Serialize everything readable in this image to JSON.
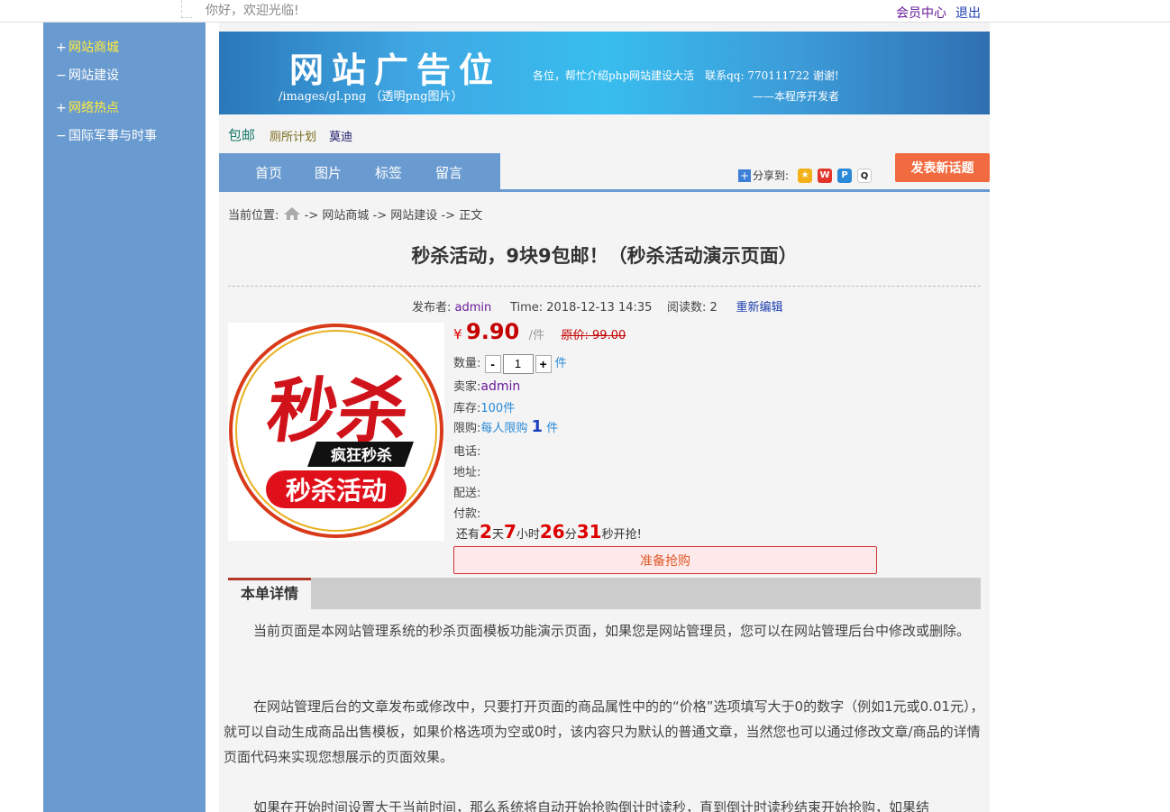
{
  "topbar": {
    "greeting": "你好，欢迎光临!",
    "member_center": "会员中心",
    "logout": "退出"
  },
  "sidebar": {
    "items": [
      {
        "marker": "+",
        "label": "网站商城"
      },
      {
        "marker": "−",
        "label": "网站建设"
      },
      {
        "marker": "+",
        "label": "网络热点"
      },
      {
        "marker": "−",
        "label": "国际军事与时事"
      }
    ]
  },
  "banner": {
    "title": "网站广告位",
    "subtitle": "/images/gl.png （透明png图片）",
    "message": "各位，帮忙介绍php网站建设大活　联系qq: 770111722 谢谢!",
    "signature": "——本程序开发者"
  },
  "tags": [
    "包邮",
    "厕所计划",
    "莫迪"
  ],
  "nav": {
    "items": [
      "首页",
      "图片",
      "标签",
      "留言"
    ],
    "share_label": "分享到:",
    "post_button": "发表新话题"
  },
  "breadcrumb": {
    "prefix": "当前位置:",
    "sep": "->",
    "items": [
      "网站商城",
      "网站建设",
      "正文"
    ]
  },
  "article": {
    "title": "秒杀活动，9块9包邮！（秒杀活动演示页面）",
    "publisher_label": "发布者:",
    "publisher": "admin",
    "time_label": "Time:",
    "time": "2018-12-13 14:35",
    "reads_label": "阅读数:",
    "reads": "2",
    "edit": "重新编辑"
  },
  "product": {
    "image_text_top": "秒杀",
    "image_text_mid": "疯狂秒杀",
    "image_text_bottom": "秒杀活动",
    "currency": "¥",
    "price": "9.90",
    "unit": "/件",
    "original_price": "原价: 99.00",
    "qty_label": "数量:",
    "qty_minus": "-",
    "qty_value": "1",
    "qty_plus": "+",
    "qty_unit": "件",
    "seller_label": "卖家:",
    "seller": "admin",
    "stock_label": "库存:",
    "stock": "100件",
    "limit_label": "限购:",
    "limit_prefix": "每人限购",
    "limit_num": "1",
    "limit_unit": "件",
    "phone_label": "电话:",
    "address_label": "地址:",
    "delivery_label": "配送:",
    "payment_label": "付款:",
    "countdown": {
      "prefix": "还有",
      "days": "2",
      "days_unit": "天",
      "hours": "7",
      "hours_unit": "小时",
      "minutes": "26",
      "minutes_unit": "分",
      "seconds": "31",
      "suffix": "秒开抢!"
    },
    "buy_button": "准备抢购"
  },
  "detail": {
    "tab": "本单详情",
    "paragraphs": [
      "当前页面是本网站管理系统的秒杀页面模板功能演示页面，如果您是网站管理员，您可以在网站管理后台中修改或删除。",
      "在网站管理后台的文章发布或修改中，只要打开页面的商品属性中的的“价格”选项填写大于0的数字（例如1元或0.01元），就可以自动生成商品出售模板，如果价格选项为空或0时，该内容只为默认的普通文章，当然您也可以通过修改文章/商品的详情页面代码来实现您想展示的页面效果。",
      "如果在开始时间设置大于当前时间，那么系统将自动开始抢购倒计时读秒，直到倒计时读秒结束开始抢购，如果结"
    ]
  },
  "colors": {
    "sidebar": "#6a9bd0",
    "accent_red": "#c40000",
    "post_button": "#f26a3f"
  }
}
